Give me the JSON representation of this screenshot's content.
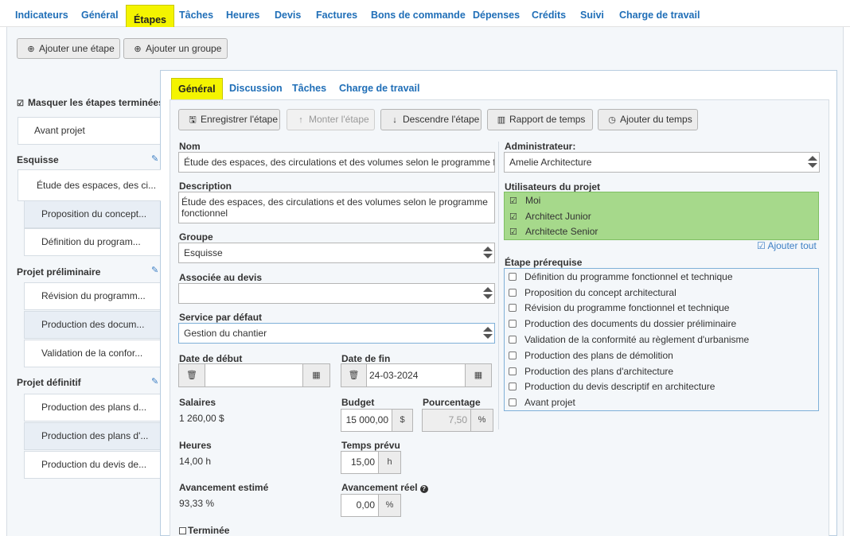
{
  "topnav": {
    "tabs": [
      "Indicateurs",
      "Général",
      "Étapes",
      "Tâches",
      "Heures",
      "Devis",
      "Factures",
      "Bons de commande",
      "Dépenses",
      "Crédits",
      "Suivi",
      "Charge de travail"
    ],
    "active": "Étapes"
  },
  "toolbar": {
    "add_step": "Ajouter une étape",
    "add_group": "Ajouter un groupe"
  },
  "sidebar": {
    "hide_completed": "Masquer les étapes terminées",
    "top_item": "Avant projet",
    "groups": [
      {
        "name": "Esquisse",
        "items": [
          "Étude des espaces, des ci...",
          "Proposition du concept...",
          "Définition du program..."
        ]
      },
      {
        "name": "Projet préliminaire",
        "items": [
          "Révision du programm...",
          "Production des docum...",
          "Validation de la confor..."
        ]
      },
      {
        "name": "Projet définitif",
        "items": [
          "Production des plans d...",
          "Production des plans d'...",
          "Production du devis de..."
        ]
      }
    ]
  },
  "subtabs": [
    "Général",
    "Discussion",
    "Tâches",
    "Charge de travail"
  ],
  "actions": {
    "save": "Enregistrer l'étape",
    "up": "Monter l'étape",
    "down": "Descendre l'étape",
    "report": "Rapport de temps",
    "add_time": "Ajouter du temps"
  },
  "form": {
    "name_label": "Nom",
    "name_value": "Étude des espaces, des circulations et des volumes selon le programme fonctionnel",
    "desc_label": "Description",
    "desc_value": "Étude des espaces, des circulations et des volumes selon le programme fonctionnel",
    "group_label": "Groupe",
    "group_value": "Esquisse",
    "quote_label": "Associée au devis",
    "quote_value": "",
    "service_label": "Service par défaut",
    "service_value": "Gestion du chantier",
    "start_label": "Date de début",
    "start_value": "",
    "end_label": "Date de fin",
    "end_value": "24-03-2024",
    "salaries_label": "Salaires",
    "salaries_value": "1 260,00 $",
    "budget_label": "Budget",
    "budget_value": "15 000,00",
    "budget_unit": "$",
    "percent_label": "Pourcentage",
    "percent_value": "7,50",
    "percent_unit": "%",
    "hours_label": "Heures",
    "hours_value": "14,00 h",
    "planned_label": "Temps prévu",
    "planned_value": "15,00",
    "planned_unit": "h",
    "est_label": "Avancement estimé",
    "est_value": "93,33 %",
    "real_label": "Avancement réel",
    "real_value": "0,00",
    "real_unit": "%",
    "done_label": "Terminée"
  },
  "right": {
    "admin_label": "Administrateur:",
    "admin_value": "Amelie Architecture",
    "users_label": "Utilisateurs du projet",
    "users": [
      "Moi",
      "Architect Junior",
      "Architecte Senior"
    ],
    "add_all": "Ajouter tout",
    "prereq_label": "Étape prérequise",
    "prereq": [
      "Définition du programme fonctionnel et technique",
      "Proposition du concept architectural",
      "Révision du programme fonctionnel et technique",
      "Production des documents du dossier préliminaire",
      "Validation de la conformité au règlement d'urbanisme",
      "Production des plans de démolition",
      "Production des plans d'architecture",
      "Production du devis descriptif en architecture",
      "Avant projet"
    ]
  },
  "colors": {
    "link": "#1f6eb7",
    "highlight": "#f4f400",
    "users_bg": "#a6d98b"
  }
}
